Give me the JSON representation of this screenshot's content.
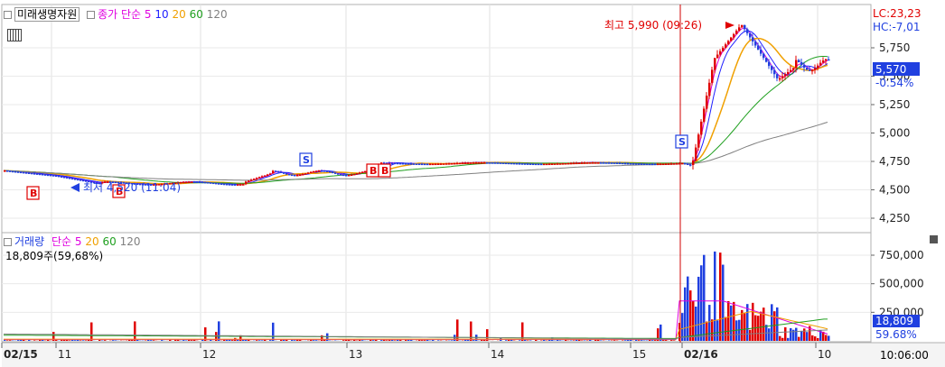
{
  "price_panel": {
    "stock_name": "미래생명자원",
    "indicator_label": "종가",
    "ma_type": "단순",
    "ma_periods": [
      "5",
      "10",
      "20",
      "60",
      "120"
    ],
    "ma_colors": [
      "#e000e0",
      "#2020ff",
      "#f0a000",
      "#20a020",
      "#808080"
    ],
    "lc_text": "LC:23,23",
    "hc_text": "HC:-7,01",
    "current_price": "5,570",
    "change_pct": "-0.54%",
    "high_note": "최고 5,990 (09:26)",
    "low_note": "최저 4,520 (11:04)",
    "signal_b": "B",
    "signal_s": "S",
    "y_ticks": [
      "5,750",
      "5,500",
      "5,250",
      "5,000",
      "4,750",
      "4,500",
      "4,250"
    ],
    "y_tick_values": [
      5750,
      5500,
      5250,
      5000,
      4750,
      4500,
      4250
    ]
  },
  "volume_panel": {
    "indicator_label": "거래량",
    "ma_type": "단순",
    "ma_periods": [
      "5",
      "20",
      "60",
      "120"
    ],
    "ma_colors": [
      "#e000e0",
      "#f0a000",
      "#20a020",
      "#808080"
    ],
    "volume_text": "18,809주(59,68%)",
    "current_volume": "18,809",
    "current_volume_pct": "59.68%",
    "y_ticks": [
      "750,000",
      "500,000",
      "250,000"
    ],
    "y_tick_values": [
      750000,
      500000,
      250000
    ]
  },
  "x_axis": {
    "labels": [
      "02/15",
      "11",
      "12",
      "13",
      "14",
      "15",
      "02/16",
      "10"
    ],
    "time_readout": "10:06:00"
  },
  "colors": {
    "up": "#e00000",
    "down": "#2040e0",
    "marker_line": "#d00000",
    "label_red": "#e00000",
    "label_blue": "#2040e0"
  }
}
